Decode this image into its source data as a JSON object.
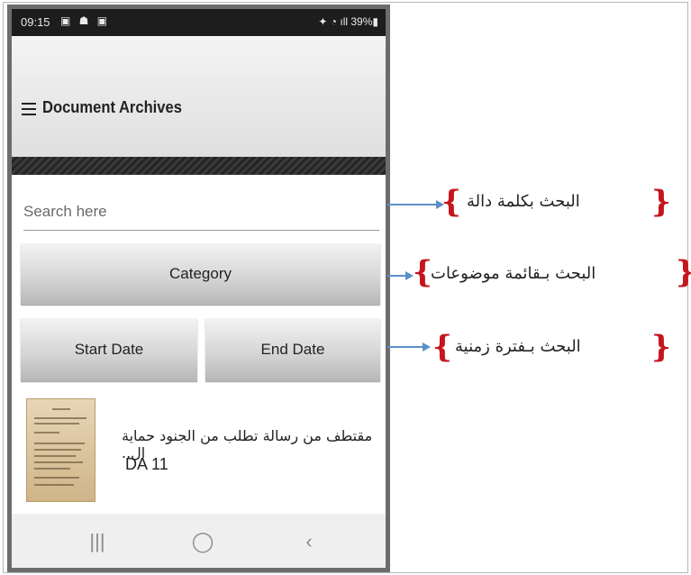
{
  "status_bar": {
    "time": "09:15",
    "left_icons": "▣ ☗ ▣",
    "right_icons": "✦ ◔ ıll",
    "battery": "39%▮"
  },
  "app_bar": {
    "menu_icon": "hamburger-menu-icon",
    "title": "Document Archives"
  },
  "search": {
    "placeholder": "Search here"
  },
  "filters": {
    "category_label": "Category",
    "start_date_label": "Start Date",
    "end_date_label": "End Date"
  },
  "documents": [
    {
      "title": "مقتطف من رسالة تطلب من الجنود حماية ال..",
      "id": "DA 11"
    }
  ],
  "nav_bar": {
    "recent_glyph": "|||",
    "home_glyph": "◯",
    "back_glyph": "‹"
  },
  "annotations": {
    "keyword_search": "البحث بكلمة دالة",
    "topic_list_search": "البحث بـقائمة موضوعات",
    "time_period_search": "البحث بـفترة زمنية"
  },
  "colors": {
    "arrow": "#5b8fc9",
    "brace": "#c5161d",
    "phone_frame": "#6c6c6c"
  }
}
